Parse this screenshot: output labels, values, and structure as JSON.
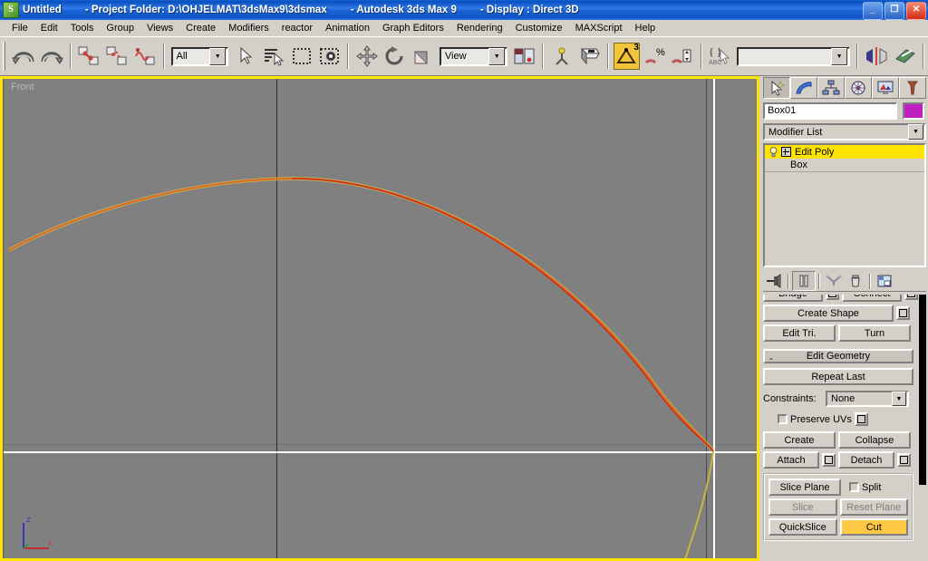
{
  "titlebar": {
    "icon": "max-app-icon",
    "doc": "Untitled",
    "project": "- Project Folder: D:\\OHJELMAT\\3dsMax9\\3dsmax",
    "app": "- Autodesk 3ds Max 9",
    "display": "- Display : Direct 3D",
    "minimize": "_",
    "maximize": "❐",
    "close": "✕"
  },
  "menu": [
    {
      "label": "File",
      "accel": "F"
    },
    {
      "label": "Edit",
      "accel": "E"
    },
    {
      "label": "Tools",
      "accel": "T"
    },
    {
      "label": "Group",
      "accel": "G"
    },
    {
      "label": "Views",
      "accel": "V"
    },
    {
      "label": "Create",
      "accel": "C"
    },
    {
      "label": "Modifiers",
      "accel": "o"
    },
    {
      "label": "reactor",
      "accel": ""
    },
    {
      "label": "Animation",
      "accel": "A"
    },
    {
      "label": "Graph Editors",
      "accel": "D"
    },
    {
      "label": "Rendering",
      "accel": "R"
    },
    {
      "label": "Customize",
      "accel": "u"
    },
    {
      "label": "MAXScript",
      "accel": "M"
    },
    {
      "label": "Help",
      "accel": "H"
    }
  ],
  "toolbar": {
    "undo": "undo-icon",
    "redo": "redo-icon",
    "select_link": "select-and-link-icon",
    "unlink": "unlink-selection-icon",
    "bind_space_warp": "bind-to-space-warp-icon",
    "selection_filter_value": "All",
    "select_object": "select-object-icon",
    "select_by_name": "select-by-name-icon",
    "select_region": "rectangular-selection-region-icon",
    "window_crossing": "window-crossing-icon",
    "select_move": "select-and-move-icon",
    "select_rotate": "select-and-rotate-icon",
    "select_scale": "select-and-uniform-scale-icon",
    "ref_coord_value": "View",
    "use_center": "use-pivot-point-center-icon",
    "select_manipulate": "select-and-manipulate-icon",
    "keyboard_shortcut": "keyboard-shortcut-override-icon",
    "snap_toggle": "snaps-toggle-icon",
    "snap_exponent": "3",
    "angle_snap": "angle-snap-toggle-icon",
    "percent_snap": "percent-snap-toggle-icon",
    "spinner_snap": "spinner-snap-toggle-icon",
    "named_sets": "named-selection-sets-icon",
    "named_sets_value": "",
    "mirror": "mirror-icon",
    "align": "align-icon"
  },
  "viewport": {
    "label": "Front",
    "axis_z": "z",
    "axis_x": "x",
    "background": "#808080",
    "active_border": "#ffe400",
    "grid_major": "#6f6f6f",
    "axis_line_dark": "#2b2b2b",
    "axis_line_white": "#ffffff",
    "edge_color": "#e06a18",
    "edge_outline": "#e8c840"
  },
  "command_panel": {
    "tabs": [
      {
        "name": "create-tab",
        "icon": "arrow-star-icon",
        "selected": true
      },
      {
        "name": "modify-tab",
        "icon": "bent-tube-icon",
        "selected": false
      },
      {
        "name": "hierarchy-tab",
        "icon": "hierarchy-tree-icon",
        "selected": false
      },
      {
        "name": "motion-tab",
        "icon": "wheel-icon",
        "selected": false
      },
      {
        "name": "display-tab",
        "icon": "monitor-icon",
        "selected": false
      },
      {
        "name": "utilities-tab",
        "icon": "hammer-icon",
        "selected": false
      }
    ],
    "object_name": "Box01",
    "object_color": "#c020c0",
    "modifier_list": "Modifier List",
    "stack": [
      {
        "label": "Edit Poly",
        "selected": true,
        "has_plus": true,
        "bulb": true
      },
      {
        "label": "Box",
        "selected": false,
        "has_plus": false,
        "bulb": false
      }
    ],
    "stack_buttons": [
      {
        "name": "pin-stack-button",
        "icon": "pin-icon"
      },
      {
        "name": "show-end-result-button",
        "icon": "show-end-result-icon",
        "pressed": true
      },
      {
        "name": "make-unique-button",
        "icon": "make-unique-icon"
      },
      {
        "name": "remove-modifier-button",
        "icon": "trash-icon"
      },
      {
        "name": "configure-modifier-sets-button",
        "icon": "configure-sets-icon"
      }
    ],
    "edit_polygons": {
      "bridge": "Bridge",
      "connect": "Connect",
      "create_shape": "Create Shape",
      "edit_tri": "Edit Tri.",
      "turn": "Turn"
    },
    "edit_geometry": {
      "header": "Edit Geometry",
      "minus": "-",
      "repeat_last": "Repeat Last",
      "constraints_label": "Constraints:",
      "constraints_value": "None",
      "preserve_uvs": "Preserve UVs",
      "create": "Create",
      "collapse": "Collapse",
      "attach": "Attach",
      "detach": "Detach",
      "slice_plane": "Slice Plane",
      "split": "Split",
      "slice": "Slice",
      "reset_plane": "Reset Plane",
      "quickslice": "QuickSlice",
      "cut": "Cut",
      "cut_active_color": "#ffc845"
    }
  }
}
